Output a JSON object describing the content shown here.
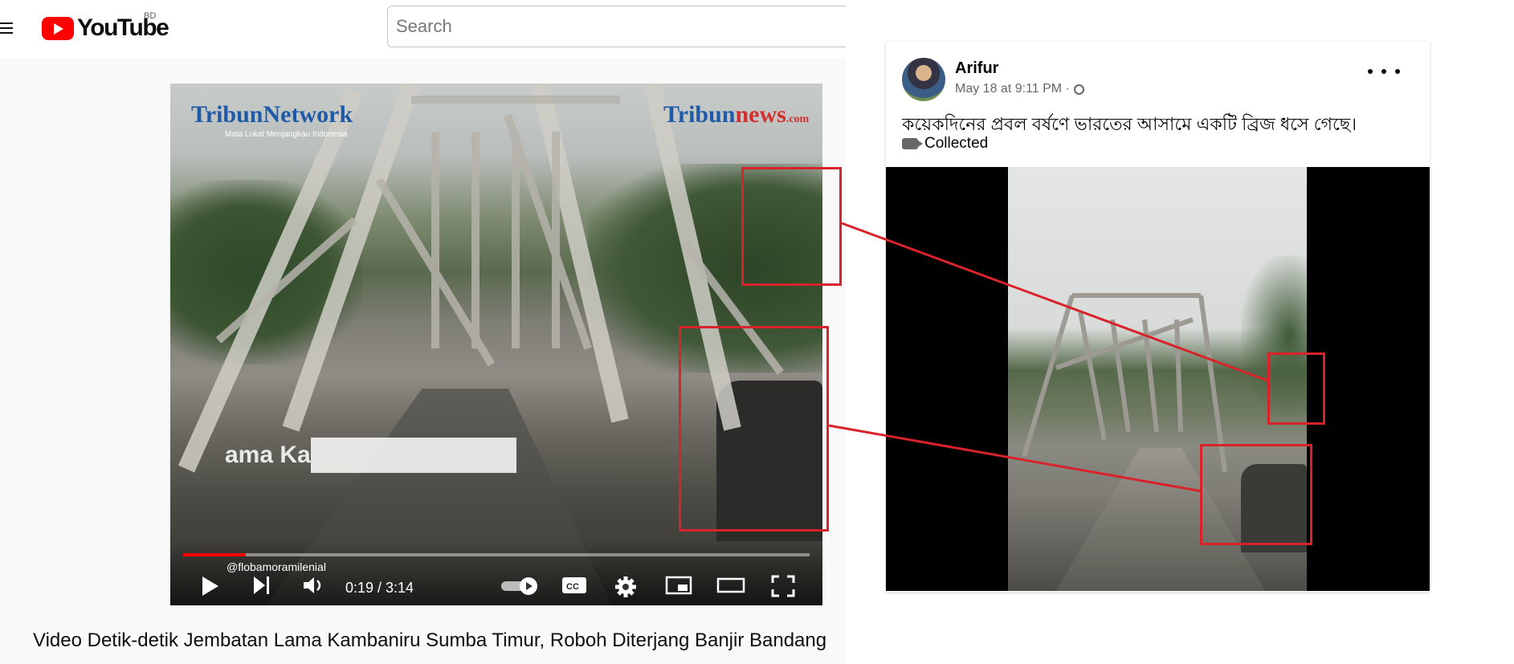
{
  "youtube": {
    "logo_text": "YouTube",
    "country_code": "BD",
    "search": {
      "placeholder": "Search"
    },
    "watermark_left": "TribunNetwork",
    "watermark_left_sub": "Mata Lokal Menjangkau Indonesia",
    "watermark_right_main": "Tribun",
    "watermark_right_news": "news",
    "watermark_right_com": ".com",
    "subtitle_partial": "ama Ka",
    "credit_handle": "@flobamoramilenial",
    "player": {
      "time": "0:19 / 3:14",
      "progress_fraction": 0.1
    },
    "video_title": "Video Detik-detik Jembatan Lama Kambaniru Sumba Timur, Roboh Diterjang Banjir Bandang"
  },
  "facebook": {
    "poster_name": "Arifur",
    "post_meta": "May 18 at 9:11 PM ·",
    "post_text": "কয়েকদিনের প্রবল বর্ষণে ভারতের আসামে একটি ব্রিজ  ধসে গেছে।",
    "collected_label": "Collected"
  },
  "annotations": {
    "highlight_color": "#d8232a"
  }
}
